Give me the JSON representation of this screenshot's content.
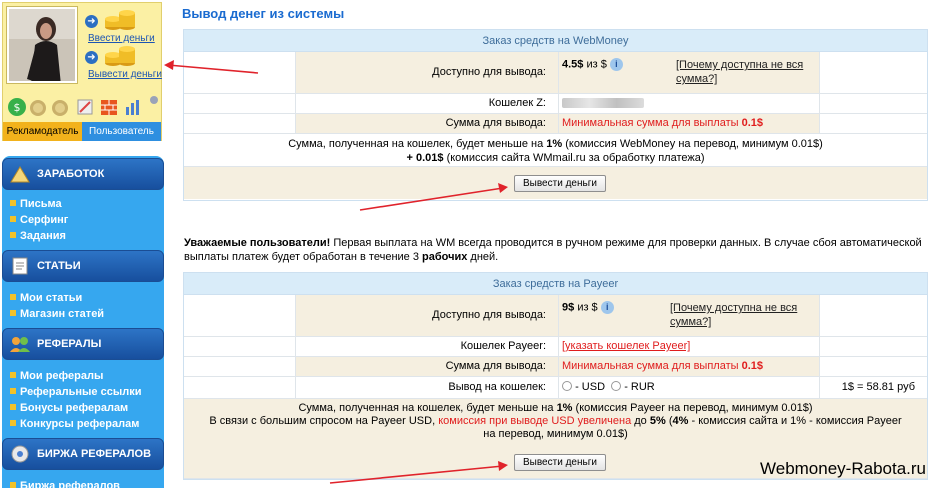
{
  "profile": {
    "deposit_label": "Ввести деньги",
    "withdraw_label": "Вывести деньги",
    "tab_advertiser": "Рекламодатель",
    "tab_user": "Пользователь"
  },
  "menu": {
    "sections": [
      {
        "title": "ЗАРАБОТОК",
        "items": [
          "Письма",
          "Серфинг",
          "Задания"
        ]
      },
      {
        "title": "СТАТЬИ",
        "items": [
          "Мои статьи",
          "Магазин статей"
        ]
      },
      {
        "title": "РЕФЕРАЛЫ",
        "items": [
          "Мои рефералы",
          "Реферальные ссылки",
          "Бонусы рефералам",
          "Конкурсы рефералам"
        ]
      },
      {
        "title": "БИРЖА РЕФЕРАЛОВ",
        "items": [
          "Биржа рефералов"
        ]
      }
    ]
  },
  "page": {
    "title": "Вывод денег из системы"
  },
  "webmoney": {
    "header": "Заказ средств на WebMoney",
    "available_label": "Доступно для вывода:",
    "available_value": "4.5$",
    "available_suffix": "из $",
    "why_link": "[Почему доступна не вся сумма?]",
    "wallet_label": "Кошелек Z:",
    "amount_label": "Сумма для вывода:",
    "min_text": "Минимальная сумма для выплаты",
    "min_value": "0.1$",
    "commission_line1_pre": "Сумма, полученная на кошелек, будет меньше на",
    "commission_line1_pct": "1%",
    "commission_line1_post": "(комиссия WebMoney на перевод, минимум 0.01$)",
    "commission_line2_amount": "+ 0.01$",
    "commission_line2_post": "(комиссия сайта WMmail.ru за обработку платежа)",
    "button": "Вывести деньги"
  },
  "notice": {
    "bold": "Уважаемые пользователи!",
    "text1": "Первая выплата на WM всегда проводится в ручном режиме для проверки данных. В случае сбоя автоматической выплаты платеж будет обработан в течение 3",
    "bold2": "рабочих",
    "text2": "дней."
  },
  "payeer": {
    "header": "Заказ средств на Payeer",
    "available_label": "Доступно для вывода:",
    "available_value": "9$",
    "available_suffix": "из $",
    "why_link": "[Почему доступна не вся сумма?]",
    "wallet_label": "Кошелек Payeer:",
    "wallet_link": "[указать кошелек Payeer]",
    "amount_label": "Сумма для вывода:",
    "min_text": "Минимальная сумма для выплаты",
    "min_value": "0.1$",
    "currency_label": "Вывод на кошелек:",
    "option_usd": "- USD",
    "option_rur": "- RUR",
    "rate": "1$ = 58.81 руб",
    "c1_pre": "Сумма, полученная на кошелек, будет меньше на",
    "c1_pct": "1%",
    "c1_post": "(комиссия Payeer на перевод, минимум 0.01$)",
    "c2_pre": "В связи с большим спросом на Payeer USD,",
    "c2_red": "комиссия при выводе USD увеличена",
    "c2_mid": "до",
    "c2_pct": "5%",
    "c2_open": "(",
    "c2_pct2": "4%",
    "c2_post": "- комиссия сайта и 1% - комиссия Payeer на перевод, минимум 0.01$)",
    "button": "Вывести деньги"
  },
  "watermark": "Webmoney-Rabota.ru",
  "colors": {
    "accent": "#1a6bd0",
    "menu": "#36a7ef",
    "annotation": "#e0232b"
  }
}
